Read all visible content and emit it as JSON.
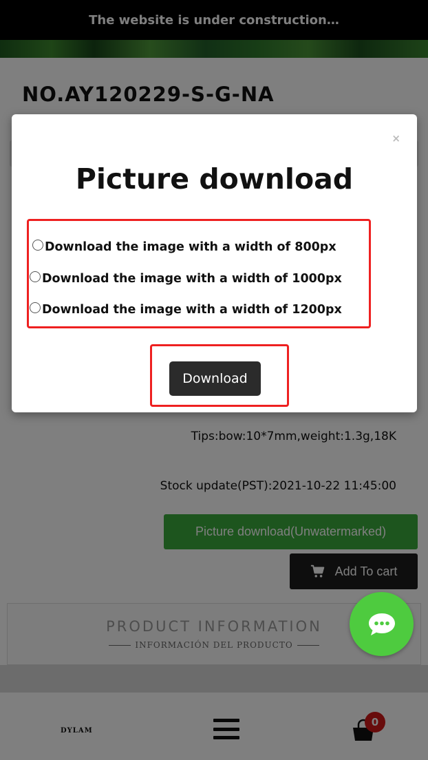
{
  "banner": {
    "text": "The website is under construction…"
  },
  "product": {
    "code": "NO.AY120229-S-G-NA",
    "tips": "Tips:bow:10*7mm,weight:1.3g,18K",
    "stock": "Stock update(PST):2021-10-22 11:45:00",
    "picture_download_label": "Picture download(Unwatermarked)",
    "add_to_cart_label": "Add To cart"
  },
  "product_info": {
    "title": "PRODUCT INFORMATION",
    "subtitle": "INFORMACIÓN DEL PRODUCTO"
  },
  "bottom_nav": {
    "brand": "DYLAM",
    "cart_count": "0"
  },
  "modal": {
    "close": "×",
    "title": "Picture download",
    "options": [
      {
        "label": "Download the image with a width of 800px"
      },
      {
        "label": "Download the image with a width of 1000px"
      },
      {
        "label": "Download the image with a width of 1200px"
      }
    ],
    "download_label": "Download"
  },
  "colors": {
    "accent_green": "#3aaa3c",
    "chat_green": "#4ecb3f",
    "highlight_red": "#ee2020",
    "badge_red": "#d01818"
  },
  "icons": [
    "cart-icon",
    "hamburger-icon",
    "bag-icon",
    "chat-icon",
    "close-icon"
  ]
}
